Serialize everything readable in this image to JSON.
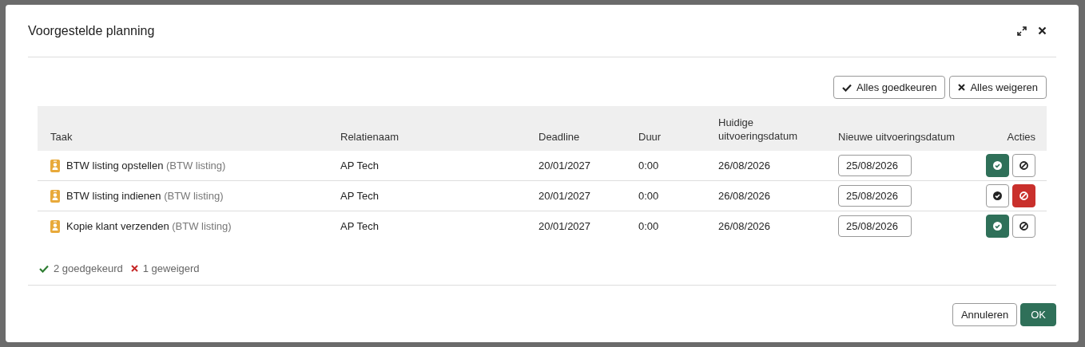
{
  "dialog": {
    "title": "Voorgestelde planning"
  },
  "bulk_actions": [
    {
      "kind": "approve",
      "label": "Alles goedkeuren"
    },
    {
      "kind": "reject",
      "label": "Alles weigeren"
    }
  ],
  "table": {
    "columns": [
      "Taak",
      "Relatienaam",
      "Deadline",
      "Duur",
      "Huidige uitvoeringsdatum",
      "Nieuwe uitvoeringsdatum",
      "Acties"
    ],
    "rows": [
      {
        "task": "BTW listing opstellen",
        "template": "(BTW listing)",
        "relation": "AP Tech",
        "deadline": "20/01/2027",
        "duration": "0:00",
        "current_date": "26/08/2026",
        "new_date": "25/08/2026",
        "actions": [
          {
            "kind": "approve",
            "selected": true
          },
          {
            "kind": "reject",
            "selected": false
          }
        ]
      },
      {
        "task": "BTW listing indienen",
        "template": "(BTW listing)",
        "relation": "AP Tech",
        "deadline": "20/01/2027",
        "duration": "0:00",
        "current_date": "26/08/2026",
        "new_date": "25/08/2026",
        "actions": [
          {
            "kind": "approve",
            "selected": false
          },
          {
            "kind": "reject",
            "selected": true
          }
        ]
      },
      {
        "task": "Kopie klant verzenden",
        "template": "(BTW listing)",
        "relation": "AP Tech",
        "deadline": "20/01/2027",
        "duration": "0:00",
        "current_date": "26/08/2026",
        "new_date": "25/08/2026",
        "actions": [
          {
            "kind": "approve",
            "selected": true
          },
          {
            "kind": "reject",
            "selected": false
          }
        ]
      }
    ]
  },
  "summary": [
    {
      "kind": "approved",
      "text": "2 goedgekeurd"
    },
    {
      "kind": "rejected",
      "text": "1 geweigerd"
    }
  ],
  "footer_buttons": [
    {
      "kind": "secondary",
      "label": "Annuleren"
    },
    {
      "kind": "primary",
      "label": "OK"
    }
  ]
}
